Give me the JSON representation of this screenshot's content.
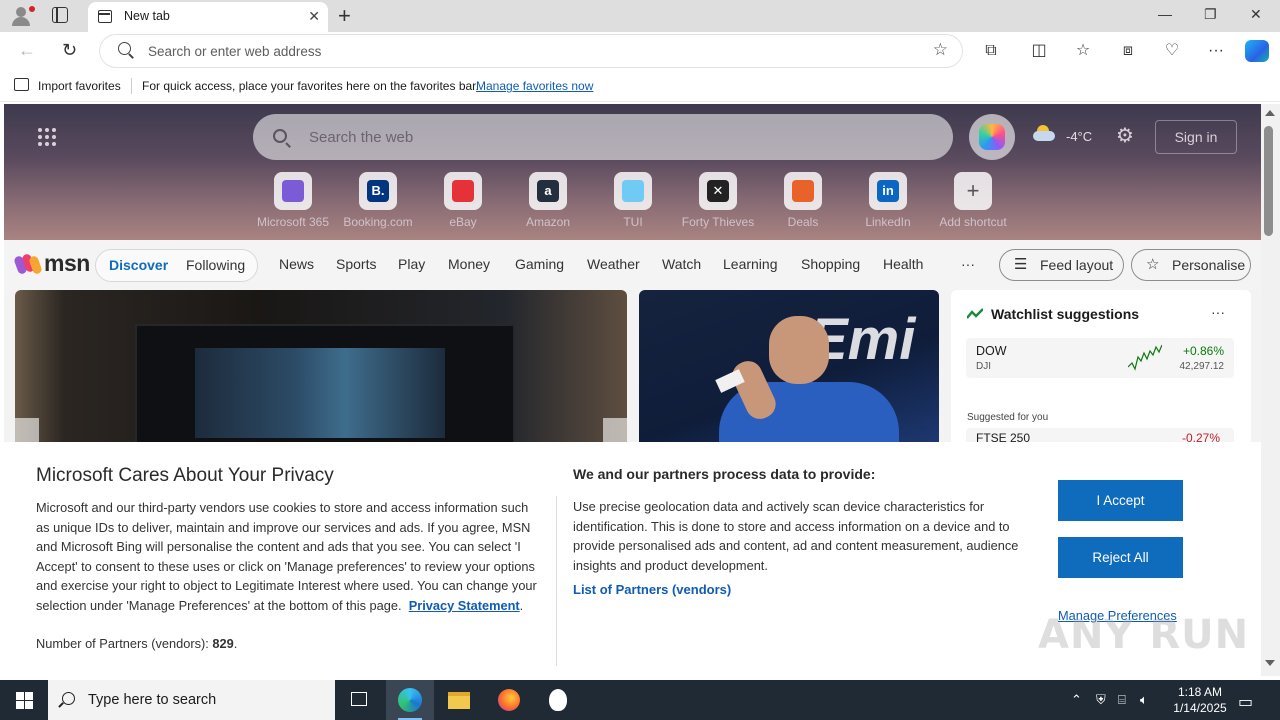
{
  "browser": {
    "tab_title": "New tab",
    "address_placeholder": "Search or enter web address",
    "favorites_bar": {
      "import_label": "Import favorites",
      "hint": "For quick access, place your favorites here on the favorites bar.",
      "manage_link": "Manage favorites now"
    }
  },
  "newtab": {
    "search_placeholder": "Search the web",
    "temperature": "-4°C",
    "sign_in": "Sign in",
    "shortcuts": [
      {
        "label": "Microsoft 365",
        "glyph": "",
        "color": "#7b5cd6"
      },
      {
        "label": "Booking.com",
        "glyph": "B.",
        "color": "#003580"
      },
      {
        "label": "eBay",
        "glyph": "",
        "color": "#e53238"
      },
      {
        "label": "Amazon",
        "glyph": "a",
        "color": "#232f3e"
      },
      {
        "label": "TUI",
        "glyph": "",
        "color": "#70cbf4"
      },
      {
        "label": "Forty Thieves",
        "glyph": "✕",
        "color": "#222222"
      },
      {
        "label": "Deals",
        "glyph": "",
        "color": "#e8622a"
      },
      {
        "label": "LinkedIn",
        "glyph": "in",
        "color": "#0a66c2"
      },
      {
        "label": "Add shortcut",
        "glyph": "+",
        "color": "transparent"
      }
    ]
  },
  "msn": {
    "logo_text": "msn",
    "toggle": {
      "discover": "Discover",
      "following": "Following"
    },
    "nav": [
      "News",
      "Sports",
      "Play",
      "Money",
      "Gaming",
      "Weather",
      "Watch",
      "Learning",
      "Shopping",
      "Health"
    ],
    "more": "···",
    "feed_layout": "Feed layout",
    "personalise": "Personalise"
  },
  "watchlist": {
    "title": "Watchlist suggestions",
    "more": "···",
    "item": {
      "symbol": "DOW",
      "sub": "DJI",
      "change": "+0.86%",
      "price": "42,297.12"
    },
    "suggested_label": "Suggested for you",
    "item2": {
      "symbol": "FTSE 250",
      "change": "-0.27%"
    }
  },
  "consent": {
    "title": "Microsoft Cares About Your Privacy",
    "body": "Microsoft and our third-party vendors use cookies to store and access information such as unique IDs to deliver, maintain and improve our services and ads. If you agree, MSN and Microsoft Bing will personalise the content and ads that you see. You can select 'I Accept' to consent to these uses or click on 'Manage preferences' to review your options and exercise your right to object to Legitimate Interest where used.  You can change your selection under 'Manage Preferences' at the bottom of this page.",
    "privacy_link": "Privacy Statement",
    "partners_count_label": "Number of Partners (vendors):",
    "partners_count": "829",
    "right_title": "We and our partners process data to provide:",
    "right_body": "Use precise geolocation data and actively scan device characteristics for identification. This is done to store and access information on a device and to provide personalised ads and content, ad and content measurement, audience insights and product development.",
    "partners_link": "List of Partners (vendors)",
    "accept": "I Accept",
    "reject": "Reject All",
    "manage": "Manage Preferences"
  },
  "taskbar": {
    "search_placeholder": "Type here to search",
    "time": "1:18 AM",
    "date": "1/14/2025"
  },
  "watermark": "ANY RUN"
}
